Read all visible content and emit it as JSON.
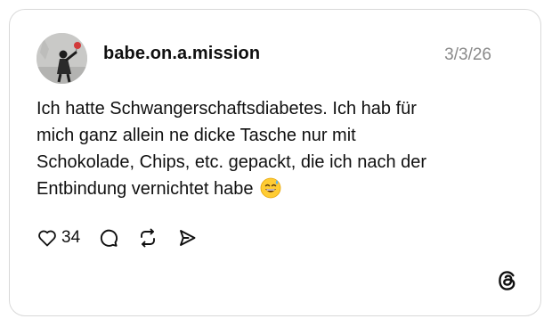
{
  "post": {
    "username": "babe.on.a.mission",
    "date": "3/3/26",
    "text_lines": [
      "Ich hatte Schwangerschaftsdiabetes. Ich hab für",
      "mich ganz allein ne dicke Tasche nur mit",
      "Schokolade, Chips, etc. gepackt, die ich nach der",
      "Entbindung vernichtet habe"
    ],
    "emoji": "grinning-face-with-sweat-emoji",
    "likes": "34"
  },
  "icons": {
    "like": "heart-icon",
    "reply": "comment-bubble-icon",
    "repost": "repost-icon",
    "share": "send-icon",
    "brand": "threads-logo-icon"
  },
  "colors": {
    "text": "#101010",
    "muted": "#8a8a8a",
    "border": "#d9d9d9"
  }
}
